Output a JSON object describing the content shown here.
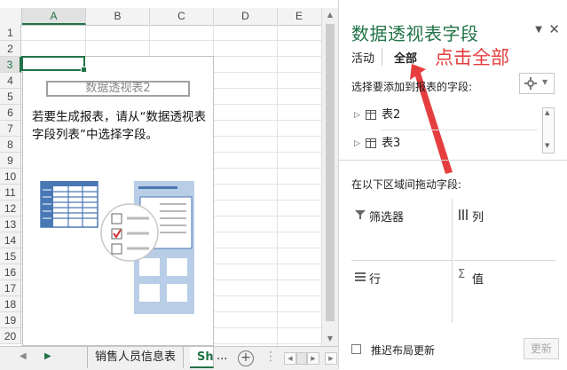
{
  "spreadsheet": {
    "columns": [
      {
        "label": "A",
        "selected": true
      },
      {
        "label": "B",
        "selected": false
      },
      {
        "label": "C",
        "selected": false
      },
      {
        "label": "D",
        "selected": false
      },
      {
        "label": "E",
        "selected": false
      }
    ],
    "rows": [
      "1",
      "2",
      "3",
      "4",
      "5",
      "6",
      "7",
      "8",
      "9",
      "10",
      "11",
      "12",
      "13",
      "14",
      "15",
      "16",
      "17",
      "18",
      "19",
      "20"
    ],
    "selected_row": "3",
    "pivot": {
      "name": "数据透视表2",
      "hint": "若要生成报表，请从“数据透视表字段列表”中选择字段。"
    }
  },
  "sheet_tabs": {
    "tabs": [
      {
        "label": "销售人员信息表",
        "active": false
      },
      {
        "label": "Sh",
        "active": true
      }
    ],
    "more_label": "...",
    "add_label": "+"
  },
  "field_pane": {
    "title": "数据透视表字段",
    "tabs": [
      {
        "label": "活动",
        "active": false
      },
      {
        "label": "全部",
        "active": true
      }
    ],
    "annotation": "点击全部",
    "annotation_color": "#e53e3e",
    "field_prompt": "选择要添加到报表的字段:",
    "tables": [
      {
        "label": "表2"
      },
      {
        "label": "表3"
      }
    ],
    "drag_prompt": "在以下区域间拖动字段:",
    "zones": {
      "filters": "筛选器",
      "columns": "列",
      "rows": "行",
      "values": "值"
    },
    "defer_label": "推迟布局更新",
    "update_label": "更新"
  },
  "colors": {
    "accent": "#217346",
    "illustration": "#4a78b5"
  }
}
